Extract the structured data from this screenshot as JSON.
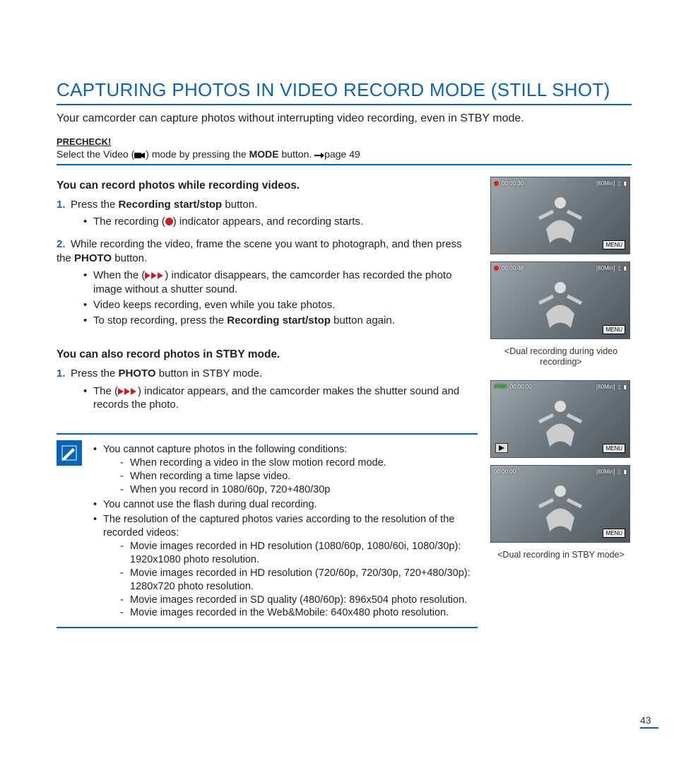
{
  "page": {
    "title": "CAPTURING PHOTOS IN VIDEO RECORD MODE (STILL SHOT)",
    "intro": "Your camcorder can capture photos without interrupting video recording, even in STBY mode.",
    "number": "43"
  },
  "precheck": {
    "label": "PRECHECK!",
    "text_a": "Select the Video (",
    "text_b": ") mode by pressing the ",
    "text_bold": "MODE",
    "text_c": " button. ",
    "page_ref": "page 49"
  },
  "icons": {
    "video_mode": "video-camera-icon",
    "record": "record-icon",
    "triple_play": "triple-play-icon",
    "arrow": "arrow-right-icon",
    "note": "note-pencil-icon"
  },
  "section_a": {
    "heading": "You can record photos while recording videos.",
    "step1": {
      "a": "Press the ",
      "bold": "Recording start/stop",
      "b": " button.",
      "bullet1_a": "The recording (",
      "bullet1_b": ") indicator appears, and recording starts."
    },
    "step2": {
      "a": "While recording the video, frame the scene you want to photograph, and then press the ",
      "bold": "PHOTO",
      "b": " button.",
      "bullet1_a": "When the (",
      "bullet1_b": ") indicator disappears, the camcorder has recorded the photo image without a shutter sound.",
      "bullet2": "Video keeps recording, even while you take photos.",
      "bullet3_a": "To stop recording, press the ",
      "bullet3_bold": "Recording start/stop",
      "bullet3_b": " button again."
    },
    "caption": "<Dual recording during video recording>",
    "shot1": {
      "time": "00:00:30",
      "remain": "[80Min]",
      "menu": "MENU"
    },
    "shot2": {
      "time": "00:00:48",
      "remain": "[80Min]",
      "menu": "MENU"
    }
  },
  "section_b": {
    "heading": "You can also record photos in STBY mode.",
    "step1": {
      "a": "Press the ",
      "bold": "PHOTO",
      "b": " button in STBY mode.",
      "bullet1_a": "The (",
      "bullet1_b": ") indicator appears, and the camcorder makes the shutter sound and records the photo."
    },
    "caption": "<Dual recording in STBY mode>",
    "shot1": {
      "stby": "STBY",
      "time": "00:00:00",
      "remain": "[80Min]",
      "menu": "MENU"
    },
    "shot2": {
      "time": "00:00:00",
      "remain": "[80Min]",
      "menu": "MENU"
    }
  },
  "note": {
    "b1": "You cannot capture photos in the following conditions:",
    "b1_d1": "When recording a video in the slow motion record mode.",
    "b1_d2": "When recording a time lapse video.",
    "b1_d3": "When you record in 1080/60p, 720+480/30p",
    "b2": "You cannot use the flash during dual recording.",
    "b3": "The resolution of the captured photos varies according to the resolution of the recorded videos:",
    "b3_d1": "Movie images recorded in HD resolution (1080/60p, 1080/60i, 1080/30p): 1920x1080 photo resolution.",
    "b3_d2": "Movie images recorded in HD resolution (720/60p, 720/30p, 720+480/30p): 1280x720 photo resolution.",
    "b3_d3": "Movie images recorded in SD quality (480/60p): 896x504 photo resolution.",
    "b3_d4": "Movie images recorded in the Web&Mobile: 640x480 photo resolution."
  }
}
